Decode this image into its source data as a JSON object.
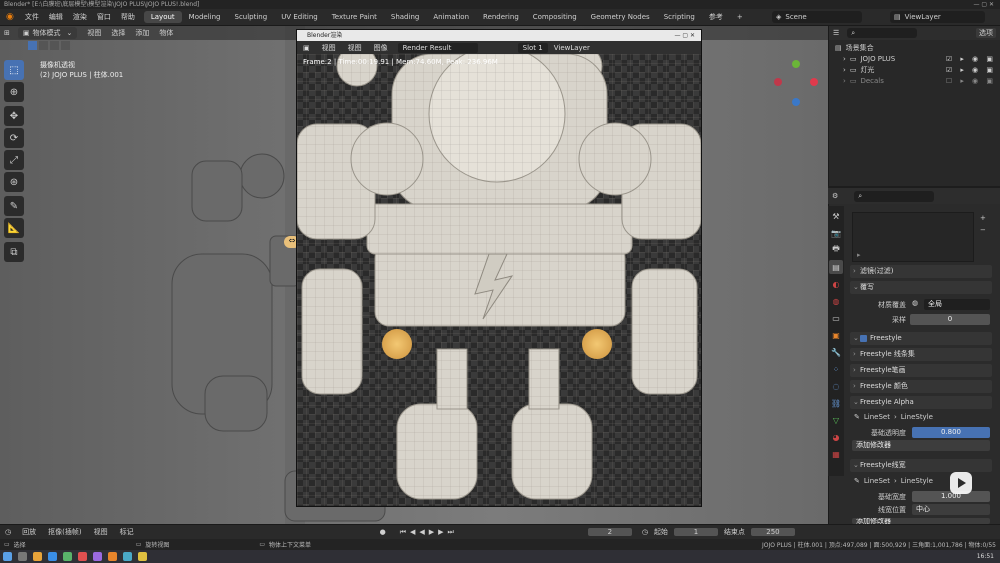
{
  "window": {
    "title": "Blender* [E:\\白膜班\\底层模型\\模型渲染\\JOJO PLUS\\JOJO PLUS!.blend]"
  },
  "menu": [
    "文件",
    "编辑",
    "渲染",
    "窗口",
    "帮助"
  ],
  "workspaces": [
    "Layout",
    "Modeling",
    "Sculpting",
    "UV Editing",
    "Texture Paint",
    "Shading",
    "Animation",
    "Rendering",
    "Compositing",
    "Geometry Nodes",
    "Scripting",
    "参考"
  ],
  "active_workspace": "Layout",
  "scene": "Scene",
  "view_layer": "ViewLayer",
  "viewport": {
    "mode": "物体模式",
    "menu": [
      "视图",
      "选择",
      "添加",
      "物体"
    ],
    "overlay_line1": "摄像机透视",
    "overlay_line2": "(2) JOJO PLUS | 柱体.001"
  },
  "render_window": {
    "title": "Blender渲染",
    "menu": [
      "视图",
      "视图",
      "图像"
    ],
    "image_name": "Render Result",
    "slot": "Slot 1",
    "layer": "ViewLayer",
    "info": "Frame:2 | Time:00:19.91 | Mem:74.60M, Peak: 236.96M"
  },
  "outliner": {
    "root": "场景集合",
    "items": [
      "JOJO PLUS",
      "灯光",
      "Decals"
    ],
    "options": "选项"
  },
  "properties": {
    "panels": [
      "滤镜(过滤)",
      "覆写",
      "Freestyle",
      "Freestyle 线条集",
      "Freestyle笔画",
      "Freestyle 颜色",
      "Freestyle Alpha",
      "添加修改器",
      "Freestyle线宽",
      "添加修改器"
    ],
    "material_override_label": "材质覆盖",
    "material_override_value": "全局",
    "samples_label": "采样",
    "samples_value": "0",
    "lineset": "LineSet",
    "linestyle": "LineStyle",
    "alpha_label": "基础透明度",
    "alpha_value": "0.800",
    "thickness_label": "基础宽度",
    "thickness_value": "1.000",
    "position_label": "线宽位置",
    "position_value": "中心"
  },
  "timeline": {
    "menu": [
      "回放",
      "抠像(插帧)",
      "视图",
      "标记"
    ],
    "current_frame": "2",
    "start_label": "起始",
    "start": "1",
    "end_label": "结束点",
    "end": "250"
  },
  "status": {
    "left": "选择",
    "mid": "旋转视图",
    "right_hint": "物体上下文菜单",
    "stats": "JOJO PLUS | 柱体.001 | 顶点:497,089 | 面:500,929 | 三角面:1,001,786 | 物体:0/55"
  },
  "clock": "16:51",
  "colors": {
    "accent": "#4772b3",
    "active_tab": "#474747"
  }
}
